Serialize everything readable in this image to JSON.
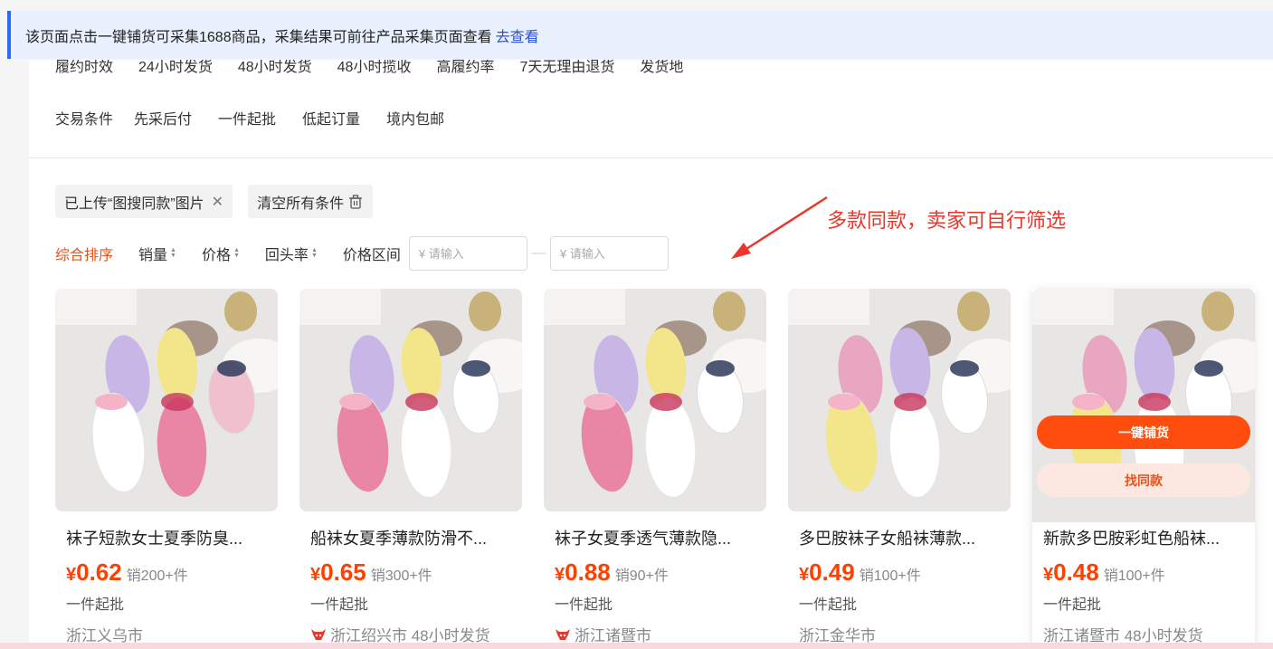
{
  "notice": {
    "text": "该页面点击一键铺货可采集1688商品，采集结果可前往产品采集页面查看",
    "link": "去查看"
  },
  "cut_row": [
    "履约时效",
    "24小时发货",
    "48小时发货",
    "48小时揽收",
    "高履约率",
    "7天无理由退货",
    "发货地"
  ],
  "trade_filter": {
    "label": "交易条件",
    "options": [
      "先采后付",
      "一件起批",
      "低起订量",
      "境内包邮"
    ]
  },
  "chips": {
    "uploaded": "已上传“图搜同款”图片",
    "clear": "清空所有条件"
  },
  "annotation": "多款同款，卖家可自行筛选",
  "sort": {
    "items": [
      "综合排序",
      "销量",
      "价格",
      "回头率"
    ],
    "price_range_label": "价格区间",
    "min_placeholder": "¥ 请输入",
    "max_placeholder": "¥ 请输入",
    "separator": "—"
  },
  "products": [
    {
      "title": "袜子短款女士夏季防臭...",
      "yen": "¥",
      "price": "0.62",
      "sold": "销200+件",
      "moq": "一件起批",
      "location": "浙江义乌市",
      "badge": false,
      "colors": [
        "#c8b7e6",
        "#f2e58a",
        "#f1c0cf",
        "#ffffff",
        "#e986a6"
      ]
    },
    {
      "title": "船袜女夏季薄款防滑不...",
      "yen": "¥",
      "price": "0.65",
      "sold": "销300+件",
      "moq": "一件起批",
      "location": "浙江绍兴市 48小时发货",
      "badge": true,
      "colors": [
        "#c8b7e6",
        "#f2e58a",
        "#ffffff",
        "#e986a6",
        "#ffffff"
      ]
    },
    {
      "title": "袜子女夏季透气薄款隐...",
      "yen": "¥",
      "price": "0.88",
      "sold": "销90+件",
      "moq": "一件起批",
      "location": "浙江诸暨市",
      "badge": true,
      "colors": [
        "#c8b7e6",
        "#f2e58a",
        "#ffffff",
        "#e986a6",
        "#ffffff"
      ]
    },
    {
      "title": "多巴胺袜子女船袜薄款...",
      "yen": "¥",
      "price": "0.49",
      "sold": "销100+件",
      "moq": "一件起批",
      "location": "浙江金华市",
      "badge": false,
      "colors": [
        "#e9a6c0",
        "#c8b7e6",
        "#ffffff",
        "#f2e58a",
        "#ffffff"
      ]
    },
    {
      "title": "新款多巴胺彩虹色船袜...",
      "yen": "¥",
      "price": "0.48",
      "sold": "销100+件",
      "moq": "一件起批",
      "location": "浙江诸暨市 48小时发货",
      "badge": false,
      "colors": [
        "#e9a6c0",
        "#c8b7e6",
        "#ffffff",
        "#f2e58a",
        "#ffffff"
      ]
    }
  ],
  "hover_buttons": {
    "primary": "一键铺货",
    "secondary": "找同款"
  },
  "colors": {
    "accent": "#ff4d0d",
    "price": "#ff4000",
    "link": "#2d4fd6",
    "annotation": "#e8382b"
  }
}
